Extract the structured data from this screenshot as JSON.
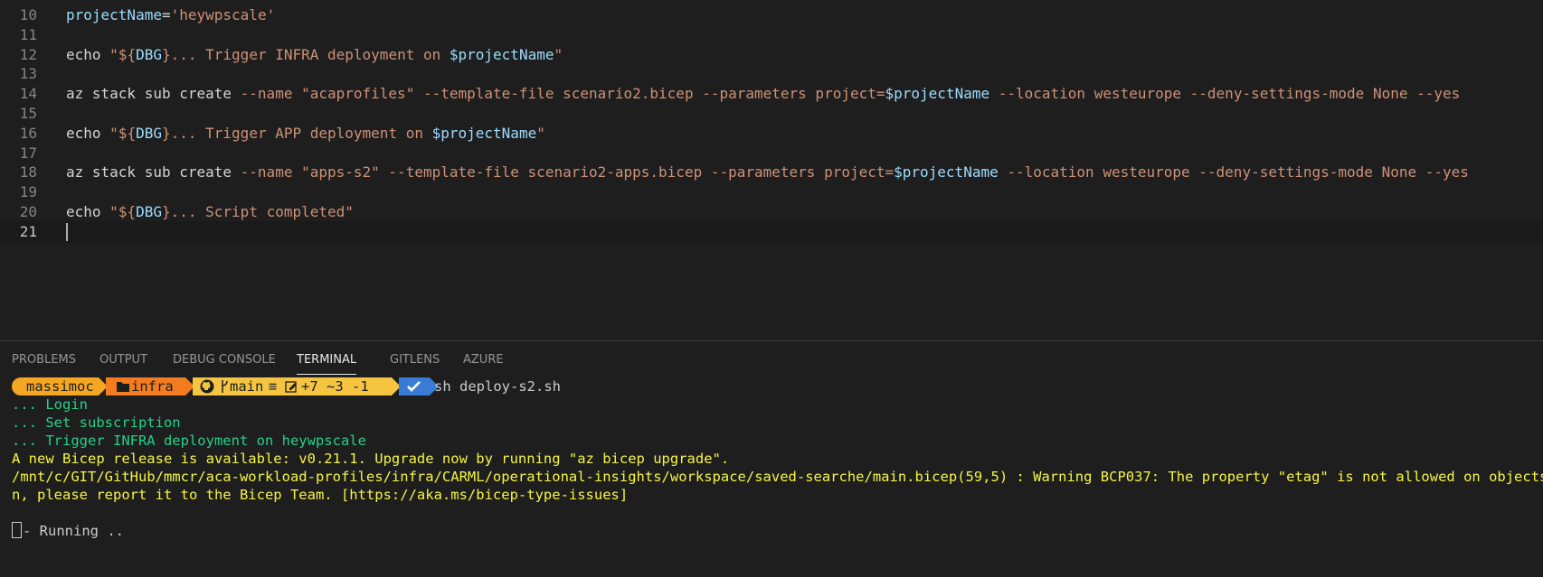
{
  "editor": {
    "lines": [
      {
        "num": "10",
        "tokens": [
          {
            "t": "projectName",
            "c": "var"
          },
          {
            "t": "=",
            "c": "txt"
          },
          {
            "t": "'heywpscale'",
            "c": "str"
          }
        ]
      },
      {
        "num": "11",
        "tokens": []
      },
      {
        "num": "12",
        "tokens": [
          {
            "t": "echo ",
            "c": "txt"
          },
          {
            "t": "\"${",
            "c": "str"
          },
          {
            "t": "DBG",
            "c": "var"
          },
          {
            "t": "}... Trigger INFRA deployment on ",
            "c": "str"
          },
          {
            "t": "$projectName",
            "c": "var"
          },
          {
            "t": "\"",
            "c": "str"
          }
        ]
      },
      {
        "num": "13",
        "tokens": []
      },
      {
        "num": "14",
        "tokens": [
          {
            "t": "az stack sub create ",
            "c": "txt"
          },
          {
            "t": "--name ",
            "c": "arg"
          },
          {
            "t": "\"acaprofiles\" ",
            "c": "str"
          },
          {
            "t": "--template-file scenario2.bicep --parameters project=",
            "c": "arg"
          },
          {
            "t": "$projectName",
            "c": "var"
          },
          {
            "t": " --location westeurope --deny-settings-mode None --yes",
            "c": "arg"
          }
        ]
      },
      {
        "num": "15",
        "tokens": []
      },
      {
        "num": "16",
        "tokens": [
          {
            "t": "echo ",
            "c": "txt"
          },
          {
            "t": "\"${",
            "c": "str"
          },
          {
            "t": "DBG",
            "c": "var"
          },
          {
            "t": "}... Trigger APP deployment on ",
            "c": "str"
          },
          {
            "t": "$projectName",
            "c": "var"
          },
          {
            "t": "\"",
            "c": "str"
          }
        ]
      },
      {
        "num": "17",
        "tokens": []
      },
      {
        "num": "18",
        "tokens": [
          {
            "t": "az stack sub create ",
            "c": "txt"
          },
          {
            "t": "--name ",
            "c": "arg"
          },
          {
            "t": "\"apps-s2\" ",
            "c": "str"
          },
          {
            "t": "--template-file scenario2-apps.bicep --parameters project=",
            "c": "arg"
          },
          {
            "t": "$projectName",
            "c": "var"
          },
          {
            "t": " --location westeurope --deny-settings-mode None --yes",
            "c": "arg"
          }
        ]
      },
      {
        "num": "19",
        "tokens": []
      },
      {
        "num": "20",
        "tokens": [
          {
            "t": "echo ",
            "c": "txt"
          },
          {
            "t": "\"${",
            "c": "str"
          },
          {
            "t": "DBG",
            "c": "var"
          },
          {
            "t": "}... Script completed\"",
            "c": "str"
          }
        ]
      },
      {
        "num": "21",
        "tokens": []
      }
    ],
    "current_line": "21"
  },
  "panel": {
    "tabs": [
      {
        "label": "PROBLEMS",
        "active": false
      },
      {
        "label": "OUTPUT",
        "active": false
      },
      {
        "label": "DEBUG CONSOLE",
        "active": false
      },
      {
        "label": "TERMINAL",
        "active": true
      },
      {
        "label": "GITLENS",
        "active": false
      },
      {
        "label": "AZURE",
        "active": false
      }
    ]
  },
  "terminal": {
    "prompt": {
      "user": "massimoc",
      "folder_icon": "folder-icon",
      "folder": "infra",
      "git_icon": "github-icon",
      "branch_icon": "branch-icon",
      "branch": "main",
      "status": "≡",
      "edit_icon": "edit-icon",
      "changes": "+7 ~3 -1",
      "check_icon": "check-icon",
      "command": "sh deploy-s2.sh"
    },
    "output": [
      {
        "text": "... Login",
        "color": "green"
      },
      {
        "text": "... Set subscription",
        "color": "green"
      },
      {
        "text": "... Trigger INFRA deployment on heywpscale",
        "color": "green"
      },
      {
        "text": "A new Bicep release is available: v0.21.1. Upgrade now by running \"az bicep upgrade\".",
        "color": "yellow"
      },
      {
        "text": "/mnt/c/GIT/GitHub/mmcr/aca-workload-profiles/infra/CARML/operational-insights/workspace/saved-searche/main.bicep(59,5) : Warning BCP037: The property \"etag\" is not allowed on objects of ty",
        "color": "yellow"
      },
      {
        "text": "n, please report it to the Bicep Team. [https://aka.ms/bicep-type-issues]",
        "color": "yellow"
      },
      {
        "text": "",
        "color": "white"
      },
      {
        "text": "- Running ..",
        "color": "white"
      }
    ]
  },
  "colors": {
    "prompt_user_bg": "#f5a623",
    "prompt_folder_bg": "#f47c20",
    "prompt_git_bg": "#f5c542",
    "prompt_check_bg": "#3a7bd5"
  }
}
